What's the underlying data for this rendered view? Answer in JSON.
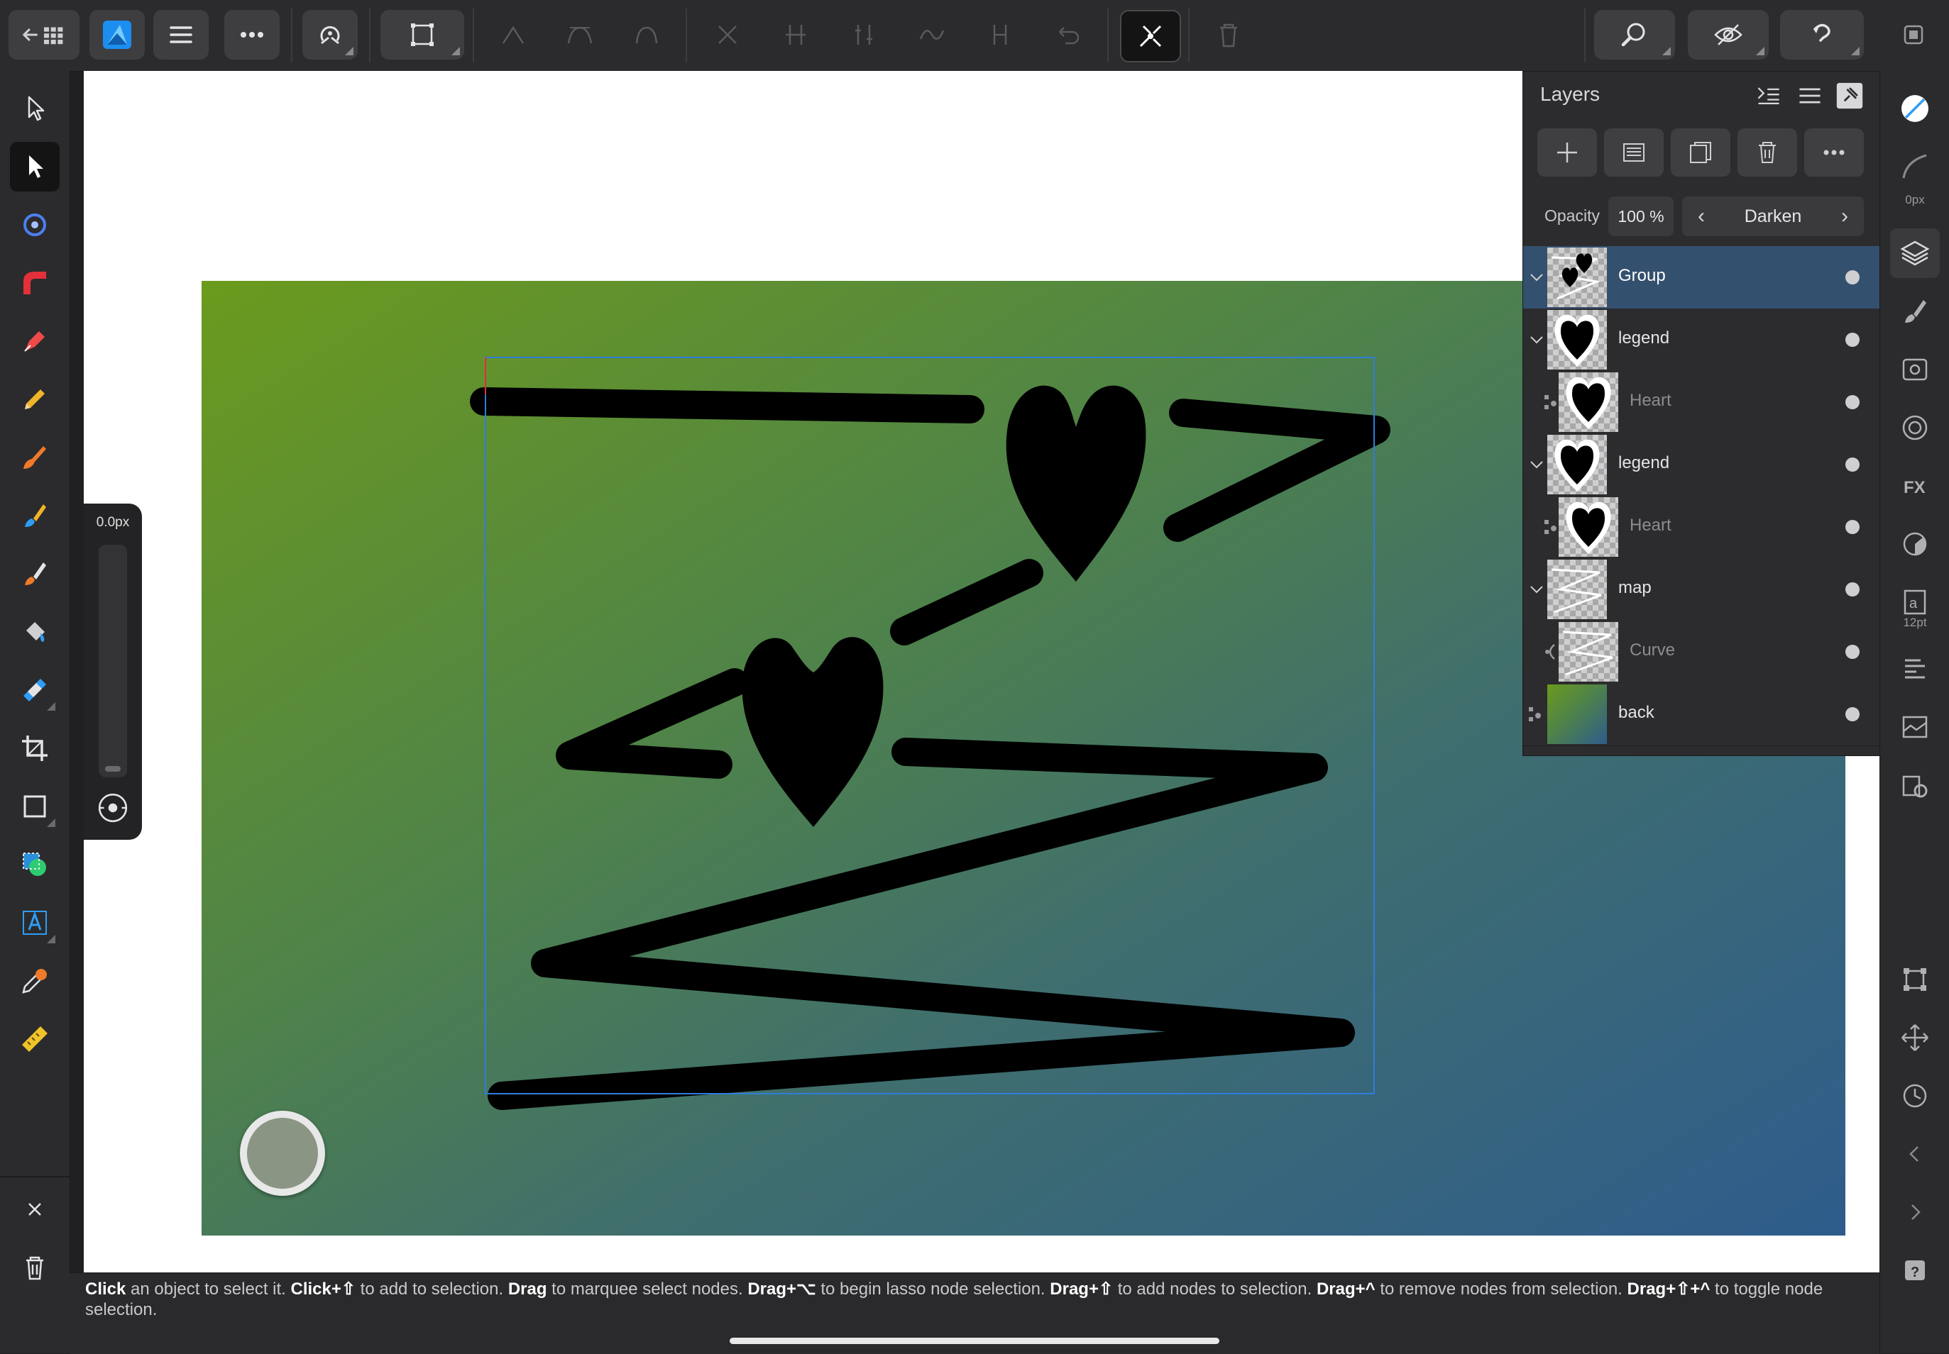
{
  "layers_panel": {
    "title": "Layers",
    "opacity_label": "Opacity",
    "opacity_value": "100 %",
    "blend_mode": "Darken",
    "rows": [
      {
        "name": "Group",
        "kind": "group",
        "selected": true
      },
      {
        "name": "legend",
        "kind": "group"
      },
      {
        "name": "Heart",
        "kind": "shape"
      },
      {
        "name": "legend",
        "kind": "group"
      },
      {
        "name": "Heart",
        "kind": "shape"
      },
      {
        "name": "map",
        "kind": "group"
      },
      {
        "name": "Curve",
        "kind": "curve"
      },
      {
        "name": "back",
        "kind": "pixel"
      }
    ]
  },
  "size_panel": {
    "value": "0.0px"
  },
  "right_strip": {
    "stroke_width_label": "0px",
    "text_size_label": "12pt"
  },
  "hint": {
    "segments": [
      {
        "b": "Click",
        "t": " an object to select it. "
      },
      {
        "b": "Click+⇧",
        "t": " to add to selection. "
      },
      {
        "b": "Drag",
        "t": " to marquee select nodes. "
      },
      {
        "b": "Drag+⌥",
        "t": " to begin lasso node selection. "
      },
      {
        "b": "Drag+⇧",
        "t": " to add nodes to selection. "
      },
      {
        "b": "Drag+^",
        "t": " to remove nodes from selection. "
      },
      {
        "b": "Drag+⇧+^",
        "t": " to toggle node selection."
      }
    ]
  },
  "colors": {
    "accent": "#2f9df5",
    "selected_layer": "#34506f",
    "gradient_start": "#6b9a1d",
    "gradient_end": "#2e5c8c"
  },
  "icons": {
    "top": [
      "back-grid-icon",
      "affinity-designer-logo",
      "hamburger-menu-icon",
      "more-icon",
      "snapping-icon",
      "transform-mode-icon",
      "sharp-node-icon",
      "smooth-node-icon",
      "smart-node-icon",
      "break-curve-icon",
      "align-nodes-icon",
      "distribute-nodes-icon",
      "smooth-curve-icon",
      "join-curves-icon",
      "reverse-curve-icon",
      "node-tool-options-icon",
      "delete-icon",
      "zoom-icon",
      "view-mode-icon",
      "history-icon",
      "persona-icon"
    ]
  }
}
